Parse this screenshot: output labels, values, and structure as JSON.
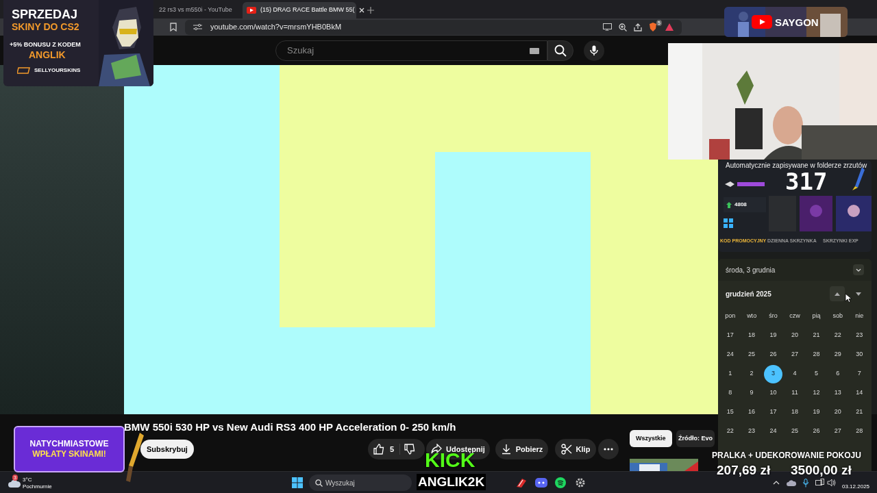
{
  "browser": {
    "tabs": [
      {
        "title": "22 rs3 vs m550i - YouTube",
        "selected": false
      },
      {
        "title": "(15) DRAG RACE Battle BMW 55(",
        "selected": true
      }
    ],
    "url": "youtube.com/watch?v=mrsmYHB0BkM",
    "extension_badge": "5"
  },
  "youtube": {
    "search": {
      "placeholder": "Szukaj"
    },
    "title": "BMW 550i 530 HP vs New Audi RS3 400 HP Acceleration 0- 250 km/h",
    "subscribe": "Subskrybuj",
    "likes": "5",
    "actions": [
      "Udostępnij",
      "Pobierz",
      "Klip"
    ],
    "chips": [
      {
        "label": "Wszystkie",
        "selected": true
      },
      {
        "label": "Źródło: Evo",
        "selected": false
      }
    ]
  },
  "overlays": {
    "top_ad": {
      "line_1": "SPRZEDAJ",
      "line_2": "SKINY DO CS2",
      "line_3": "+5% BONUSU Z KODEM",
      "line_4": "ANGLIK",
      "brand": "SELLYOURSKINS"
    },
    "channel_banner": "SAYGON",
    "counter": "317",
    "notification": "Automatycznie zapisywane w folderze zrzutów",
    "site": {
      "balance": "4808",
      "links": [
        "KOD PROMOCYJNY",
        "DZIENNA SKRZYNKA",
        "SKRZYNKI EXP"
      ]
    },
    "bottom_ad": {
      "line_1": "NATYCHMIASTOWE",
      "line_2": "WPŁATY SKINAMI!"
    },
    "kick": {
      "logo": "KICK",
      "name": "ANGLIK2K"
    },
    "goal": {
      "title": "PRALKA + UDEKOROWANIE POKOJU",
      "current": "207,69 zł",
      "target": "3500,00 zł"
    }
  },
  "calendar": {
    "date": "środa, 3 grudnia",
    "month": "grudzień 2025",
    "weekdays": [
      "pon",
      "wto",
      "śro",
      "czw",
      "pią",
      "sob",
      "nie"
    ],
    "weeks": [
      [
        {
          "day": "17",
          "selected": false
        },
        {
          "day": "18",
          "selected": false
        },
        {
          "day": "19",
          "selected": false
        },
        {
          "day": "20",
          "selected": false
        },
        {
          "day": "21",
          "selected": false
        },
        {
          "day": "22",
          "selected": false
        },
        {
          "day": "23",
          "selected": false
        }
      ],
      [
        {
          "day": "24",
          "selected": false
        },
        {
          "day": "25",
          "selected": false
        },
        {
          "day": "26",
          "selected": false
        },
        {
          "day": "27",
          "selected": false
        },
        {
          "day": "28",
          "selected": false
        },
        {
          "day": "29",
          "selected": false
        },
        {
          "day": "30",
          "selected": false
        }
      ],
      [
        {
          "day": "1",
          "selected": false
        },
        {
          "day": "2",
          "selected": false
        },
        {
          "day": "3",
          "selected": true
        },
        {
          "day": "4",
          "selected": false
        },
        {
          "day": "5",
          "selected": false
        },
        {
          "day": "6",
          "selected": false
        },
        {
          "day": "7",
          "selected": false
        }
      ],
      [
        {
          "day": "8",
          "selected": false
        },
        {
          "day": "9",
          "selected": false
        },
        {
          "day": "10",
          "selected": false
        },
        {
          "day": "11",
          "selected": false
        },
        {
          "day": "12",
          "selected": false
        },
        {
          "day": "13",
          "selected": false
        },
        {
          "day": "14",
          "selected": false
        }
      ],
      [
        {
          "day": "15",
          "selected": false
        },
        {
          "day": "16",
          "selected": false
        },
        {
          "day": "17",
          "selected": false
        },
        {
          "day": "18",
          "selected": false
        },
        {
          "day": "19",
          "selected": false
        },
        {
          "day": "20",
          "selected": false
        },
        {
          "day": "21",
          "selected": false
        }
      ],
      [
        {
          "day": "22",
          "selected": false
        },
        {
          "day": "23",
          "selected": false
        },
        {
          "day": "24",
          "selected": false
        },
        {
          "day": "25",
          "selected": false
        },
        {
          "day": "26",
          "selected": false
        },
        {
          "day": "27",
          "selected": false
        },
        {
          "day": "28",
          "selected": false
        }
      ]
    ]
  },
  "taskbar": {
    "weather": {
      "temperature": "3°C",
      "condition": "Pochmurnie",
      "badge": "3"
    },
    "search": {
      "placeholder": "Wyszukaj"
    },
    "date": "03.12.2025"
  }
}
